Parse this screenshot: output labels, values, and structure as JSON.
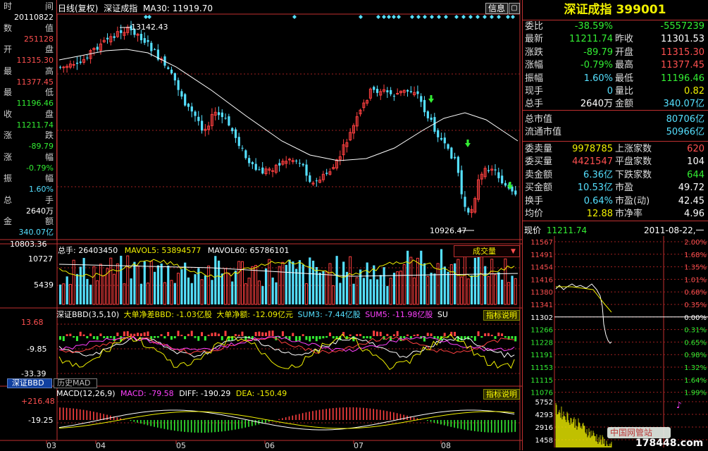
{
  "left_panel": {
    "rows": [
      {
        "k1": "时",
        "k2": "间",
        "val": "20110822",
        "color": "#ffffff"
      },
      {
        "k1": "数",
        "k2": "值",
        "val": "251128",
        "color": "#ff5050"
      },
      {
        "k1": "开",
        "k2": "盘",
        "val": "11315.30",
        "color": "#ff5050"
      },
      {
        "k1": "最",
        "k2": "高",
        "val": "11377.45",
        "color": "#ff5050"
      },
      {
        "k1": "最",
        "k2": "低",
        "val": "11196.46",
        "color": "#33ee33"
      },
      {
        "k1": "收",
        "k2": "盘",
        "val": "11211.74",
        "color": "#33ee33"
      },
      {
        "k1": "涨",
        "k2": "跌",
        "val": "-89.79",
        "color": "#33ee33"
      },
      {
        "k1": "涨",
        "k2": "幅",
        "val": "-0.79%",
        "color": "#33ee33"
      },
      {
        "k1": "振",
        "k2": "幅",
        "val": "1.60%",
        "color": "#55e0ff"
      },
      {
        "k1": "总",
        "k2": "手",
        "val": "2640万",
        "color": "#ffffff"
      },
      {
        "k1": "金",
        "k2": "额",
        "val": "340.07亿",
        "color": "#55e0ff"
      }
    ]
  },
  "kline": {
    "header": "日线(复权)",
    "name": "深证成指",
    "ma": "MA30: 11919.70",
    "info_btn": "信息",
    "max_label": "13142.43",
    "min_label": "10926.47",
    "vol_axis_top": "10803.36"
  },
  "volume": {
    "legend_total": "总手: 26403450",
    "legend_ma5": "MAVOL5: 53894577",
    "legend_ma60": "MAVOL60: 65786101",
    "dropdown": "成交量",
    "axis": [
      "10727",
      "5439"
    ]
  },
  "bbd": {
    "legend_title": "深证BBD(3,5,10)",
    "legend_big": "大单净差BBD: -1.03亿股",
    "legend_net": "大单净额: -12.09亿元",
    "legend_sum3": "SUM3: -7.44亿股",
    "legend_sum5": "SUM5: -11.98亿股",
    "legend_more": "SU",
    "explain": "指标说明",
    "axis": [
      "13.68",
      "-9.85",
      "-33.39"
    ]
  },
  "tabs": [
    "深证BBD",
    "历史MAD"
  ],
  "macd": {
    "legend_title": "MACD(12,26,9)",
    "legend_macd": "MACD: -79.58",
    "legend_diff": "DIFF: -190.29",
    "legend_dea": "DEA: -150.49",
    "explain": "指标说明",
    "axis": [
      "+216.48",
      "-19.25"
    ]
  },
  "months": [
    "03",
    "04",
    "05",
    "06",
    "07",
    "08"
  ],
  "right_panel": {
    "title": "深证成指",
    "code": "399001",
    "rows": [
      {
        "l1": "委比",
        "v1": "-38.59%",
        "c1": "#33ee33",
        "l2": "",
        "v2": "-5557239",
        "c2": "#33ee33"
      },
      {
        "l1": "最新",
        "v1": "11211.74",
        "c1": "#33ee33",
        "l2": "昨收",
        "v2": "11301.53",
        "c2": "#ffffff"
      },
      {
        "l1": "涨跌",
        "v1": "-89.79",
        "c1": "#33ee33",
        "l2": "开盘",
        "v2": "11315.30",
        "c2": "#ff5050"
      },
      {
        "l1": "涨幅",
        "v1": "-0.79%",
        "c1": "#33ee33",
        "l2": "最高",
        "v2": "11377.45",
        "c2": "#ff5050"
      },
      {
        "l1": "振幅",
        "v1": "1.60%",
        "c1": "#55e0ff",
        "l2": "最低",
        "v2": "11196.46",
        "c2": "#33ee33"
      },
      {
        "l1": "现手",
        "v1": "0",
        "c1": "#55e0ff",
        "l2": "量比",
        "v2": "0.82",
        "c2": "#f0f000"
      },
      {
        "l1": "总手",
        "v1": "2640万",
        "c1": "#ffffff",
        "l2": "金额",
        "v2": "340.07亿",
        "c2": "#55e0ff"
      }
    ],
    "rows2": [
      {
        "l1": "总市值",
        "v1": "",
        "c1": "#ffffff",
        "l2": "",
        "v2": "80706亿",
        "c2": "#55e0ff"
      },
      {
        "l1": "流通市值",
        "v1": "",
        "c1": "#ffffff",
        "l2": "",
        "v2": "50966亿",
        "c2": "#55e0ff"
      }
    ],
    "rows3": [
      {
        "l1": "委卖量",
        "v1": "9978785",
        "c1": "#f0f000",
        "l2": "上涨家数",
        "v2": "620",
        "c2": "#ff5050"
      },
      {
        "l1": "委买量",
        "v1": "4421547",
        "c1": "#ff5050",
        "l2": "平盘家数",
        "v2": "104",
        "c2": "#ffffff"
      },
      {
        "l1": "卖金额",
        "v1": "6.36亿",
        "c1": "#55e0ff",
        "l2": "下跌家数",
        "v2": "644",
        "c2": "#33ee33"
      },
      {
        "l1": "买金额",
        "v1": "10.53亿",
        "c1": "#55e0ff",
        "l2": "市盈",
        "v2": "49.72",
        "c2": "#ffffff"
      },
      {
        "l1": "换手",
        "v1": "0.64%",
        "c1": "#55e0ff",
        "l2": "市盈(动)",
        "v2": "42.45",
        "c2": "#ffffff"
      },
      {
        "l1": "均价",
        "v1": "12.88",
        "c1": "#f0f000",
        "l2": "市净率",
        "v2": "4.96",
        "c2": "#ffffff"
      }
    ],
    "intraday_label": "现价",
    "intraday_price": "11211.74",
    "intraday_date": "2011-08-22,一",
    "price_axis": [
      "11567",
      "11491",
      "11454",
      "11416",
      "11380",
      "11341",
      "11302",
      "11266",
      "11228",
      "11191",
      "11153",
      "11115",
      "11076"
    ],
    "pct_axis": [
      "2.00%",
      "1.68%",
      "1.35%",
      "1.01%",
      "0.68%",
      "0.35%",
      "0.00%",
      "0.31%",
      "0.65%",
      "0.98%",
      "1.32%",
      "1.64%",
      "1.99%"
    ],
    "vol_axis": [
      "5752",
      "4293",
      "2916",
      "1458"
    ],
    "watermark": "中国网管站",
    "site": "178448.com"
  }
}
